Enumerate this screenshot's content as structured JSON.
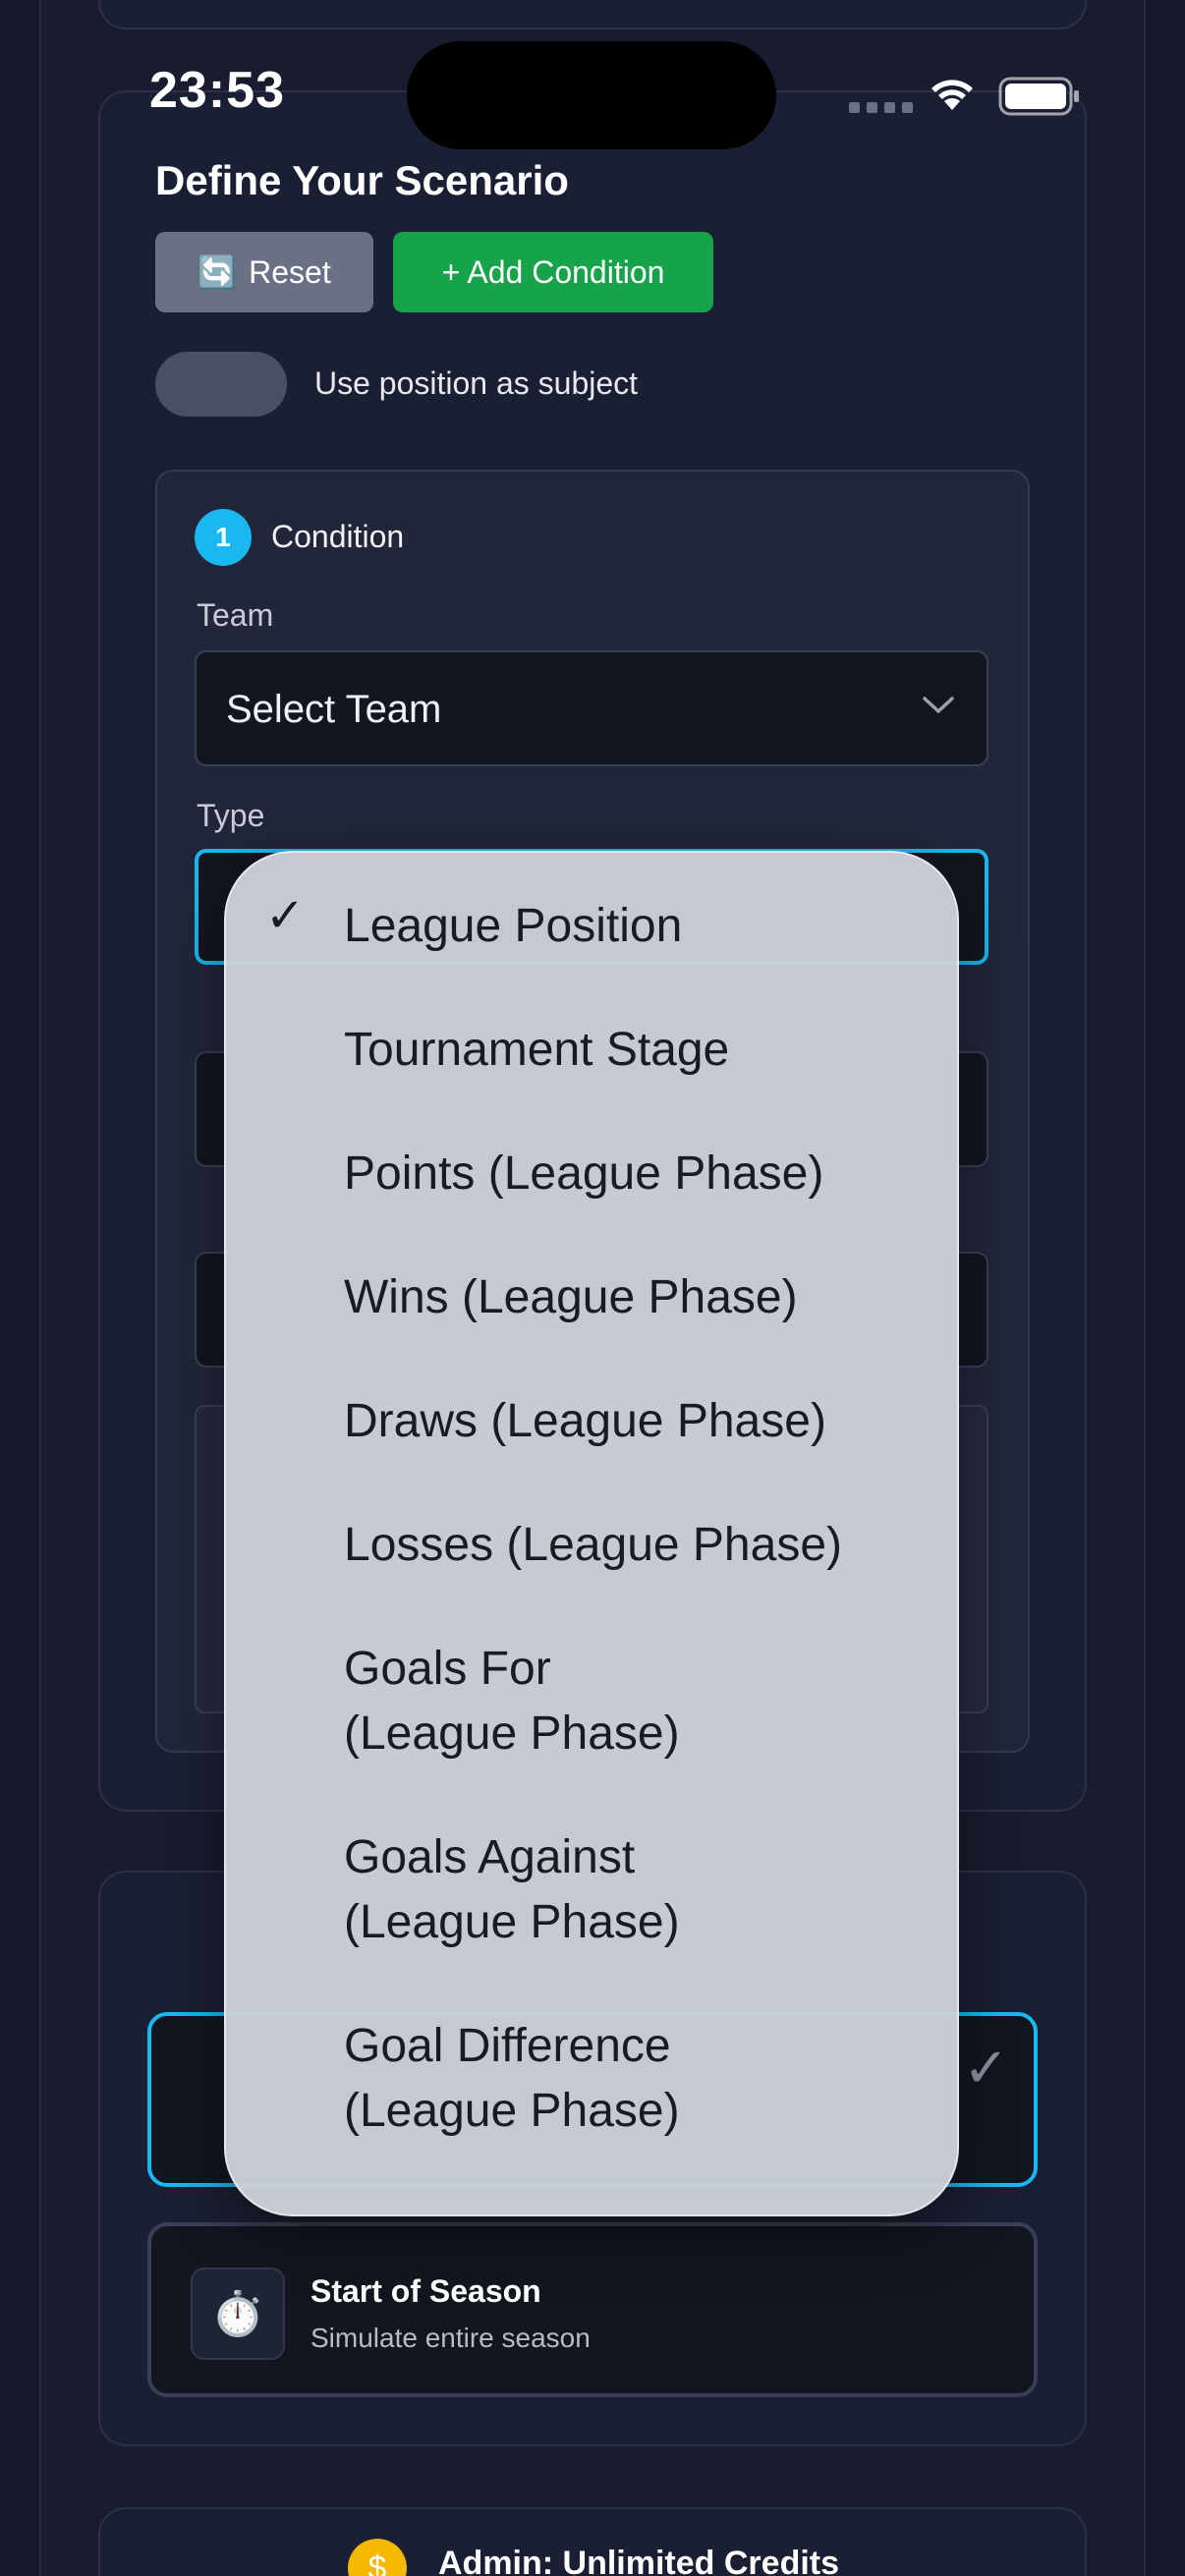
{
  "status_bar": {
    "time": "23:53"
  },
  "scenario": {
    "title": "Define Your Scenario",
    "reset_label": "Reset",
    "reset_icon": "🔄",
    "add_condition_label": "+ Add Condition",
    "toggle_label": "Use position as subject"
  },
  "condition": {
    "number": "1",
    "label": "Condition",
    "team_label": "Team",
    "team_value": "Select Team",
    "type_label": "Type"
  },
  "dropdown": {
    "selected": "League Position",
    "options": [
      "League Position",
      "Tournament Stage",
      "Points (League Phase)",
      "Wins (League Phase)",
      "Draws (League Phase)",
      "Losses (League Phase)",
      "Goals For\n(League Phase)",
      "Goals Against\n(League Phase)",
      "Goal Difference\n(League Phase)"
    ]
  },
  "timing": {
    "start_title": "Start of Season",
    "start_subtitle": "Simulate entire season",
    "start_icon": "⏱️"
  },
  "credits": {
    "label": "Admin: Unlimited Credits"
  },
  "colors": {
    "accent": "#1ab8f0",
    "add_button": "#16a34a",
    "background": "#141829"
  }
}
